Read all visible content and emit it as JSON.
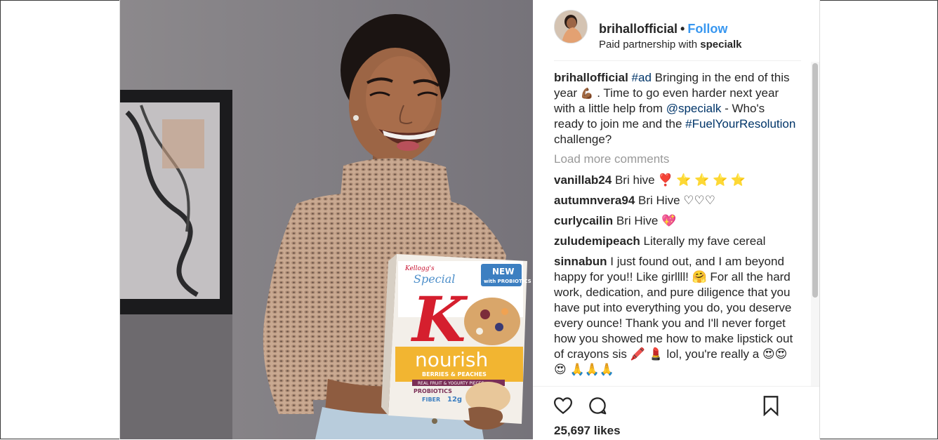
{
  "post": {
    "username": "brihallofficial",
    "separator": "•",
    "follow_label": "Follow",
    "partnership_prefix": "Paid partnership with ",
    "partner_name": "specialk",
    "caption": {
      "username": "brihallofficial",
      "segments": [
        {
          "text": "#ad",
          "link": true
        },
        {
          "text": " Bringing in the end of this year ",
          "link": false
        },
        {
          "text": "💪🏾",
          "emoji": true
        },
        {
          "text": " . Time to go even harder next year with a little help from ",
          "link": false
        },
        {
          "text": "@specialk",
          "link": true
        },
        {
          "text": " - Who's ready to join me and the ",
          "link": false
        },
        {
          "text": "#FuelYourResolution",
          "link": true
        },
        {
          "text": " challenge?",
          "link": false
        }
      ]
    },
    "load_more_label": "Load more comments",
    "comments": [
      {
        "user": "vanillab24",
        "text": "Bri hive ❣️ ⭐ ⭐ ⭐ ⭐"
      },
      {
        "user": "autumnvera94",
        "text": "Bri Hive ♡♡♡"
      },
      {
        "user": "curlycailin",
        "text": "Bri Hive 💖"
      },
      {
        "user": "zuludemipeach",
        "text": "Literally my fave cereal"
      },
      {
        "user": "sinnabun",
        "text": "I just found out, and I am beyond happy for you!! Like girllll! 🤗  For all the hard work, dedication, and pure diligence that you have put into everything you do, you deserve every ounce! Thank you and I'll never forget how you showed me how to make lipstick out of crayons sis 🖍️ 💄  lol, you're really a 😍😍😍 🙏🙏🙏"
      }
    ],
    "likes": "25,697 likes",
    "icons": [
      "heart-icon",
      "comment-icon",
      "bookmark-icon"
    ],
    "colors": {
      "link": "#003569",
      "follow": "#3897f0",
      "muted": "#999999"
    }
  },
  "photo": {
    "box": {
      "brand": "Kellogg's",
      "name": "Special",
      "letter": "K",
      "badge": "NEW",
      "badge_sub": "with PROBIOTICS",
      "product": "nourish",
      "flavor": "BERRIES & PEACHES",
      "sub": "REAL FRUIT & YOGURTY PIECES",
      "probiotics": "PROBIOTICS",
      "fiber": "FIBER",
      "grams": "12g"
    }
  }
}
